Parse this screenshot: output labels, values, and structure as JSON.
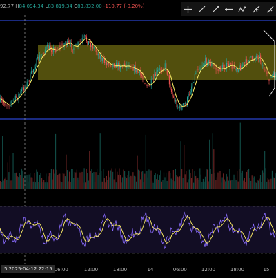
{
  "colors": {
    "background": "#000000",
    "candle_up": "#26a69a",
    "candle_down": "#ef5350",
    "moving_average": "#f5e663",
    "zone_fill": "#6d6a12",
    "channel_line": "#3355ff",
    "oscillator": "#8a6cff",
    "crosshair": "#8a8a8a"
  },
  "ohlc_legend": {
    "partial_value": "92.77",
    "high_label": "H",
    "high": "84,094.34",
    "low_label": "L",
    "low": "83,819.34",
    "close_label": "C",
    "close": "83,832.00",
    "change": "-110.77 (-0.20%)"
  },
  "toolbar": {
    "tools": [
      {
        "name": "crosshair-tool-icon",
        "icon": "crosshair"
      },
      {
        "name": "trend-line-tool-icon",
        "icon": "line"
      },
      {
        "name": "ray-tool-icon",
        "icon": "ray"
      },
      {
        "name": "horizontal-line-tool-icon",
        "icon": "hline"
      },
      {
        "name": "path-tool-icon",
        "icon": "path"
      },
      {
        "name": "pitchfork-tool-icon",
        "icon": "fork"
      },
      {
        "name": "brush-tool-icon",
        "icon": "brush"
      }
    ]
  },
  "time_axis": {
    "crosshair_label": "5 2025-04-12   22:15",
    "ticks": [
      {
        "label": "06:00",
        "pos": 0.222
      },
      {
        "label": "12:00",
        "pos": 0.33
      },
      {
        "label": "18:00",
        "pos": 0.435
      },
      {
        "label": "14",
        "pos": 0.545
      },
      {
        "label": "06:00",
        "pos": 0.652
      },
      {
        "label": "12:00",
        "pos": 0.755
      },
      {
        "label": "18:00",
        "pos": 0.86
      },
      {
        "label": "15",
        "pos": 0.965
      }
    ]
  }
}
